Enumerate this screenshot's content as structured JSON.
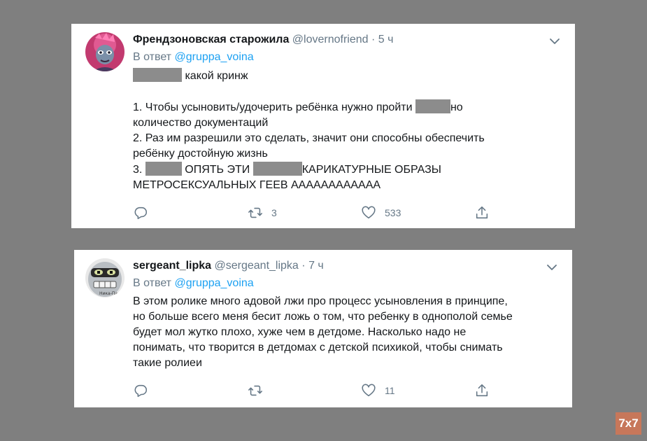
{
  "tweets": [
    {
      "name": "Френдзоновская старожила",
      "handle": "@lovernofriend",
      "separator": "·",
      "time": "5 ч",
      "reply_prefix": "В ответ",
      "reply_to": "@gruppa_voina",
      "lines": [
        [
          "какой кринж"
        ],
        [
          "1. Чтобы усыновить/удочерить ребёнка нужно пройти",
          "но"
        ],
        [
          "количество документаций"
        ],
        [
          "2. Раз им разрешили это сделать, значит они способны обеспечить"
        ],
        [
          "ребёнку достойную жизнь"
        ],
        [
          "3.",
          "ОПЯТЬ ЭТИ",
          "КАРИКАТУРНЫЕ ОБРАЗЫ"
        ],
        [
          "МЕТРОСЕКСУАЛЬНЫХ ГЕЕВ АААААААААААА"
        ]
      ],
      "retweet_count": "3",
      "like_count": "533"
    },
    {
      "name": "sergeant_lipka",
      "handle": "@sergeant_lipka",
      "separator": "·",
      "time": "7 ч",
      "reply_prefix": "В ответ",
      "reply_to": "@gruppa_voina",
      "lines": [
        "В этом ролике много адовой лжи про процесс усыновления в принципе,",
        "но больше всего меня бесит ложь о том, что ребенку в однополой семье",
        "будет мол жутко плохо, хуже чем в детдоме. Насколько надо не",
        "понимать, что творится в детдомах с детской психикой, чтобы снимать",
        "такие ролиеи"
      ],
      "retweet_count": "",
      "like_count": "11"
    }
  ],
  "avatar_2_text": "Ника-Пари",
  "watermark": "7x7",
  "colors": {
    "background": "#7f7f7f",
    "card": "#ffffff",
    "mention": "#1da1f2",
    "muted": "#657786",
    "redaction": "#8c8c8c",
    "watermark": "#c7775a"
  },
  "icons": [
    "chevron-down-icon",
    "reply-icon",
    "retweet-icon",
    "like-icon",
    "share-icon"
  ]
}
